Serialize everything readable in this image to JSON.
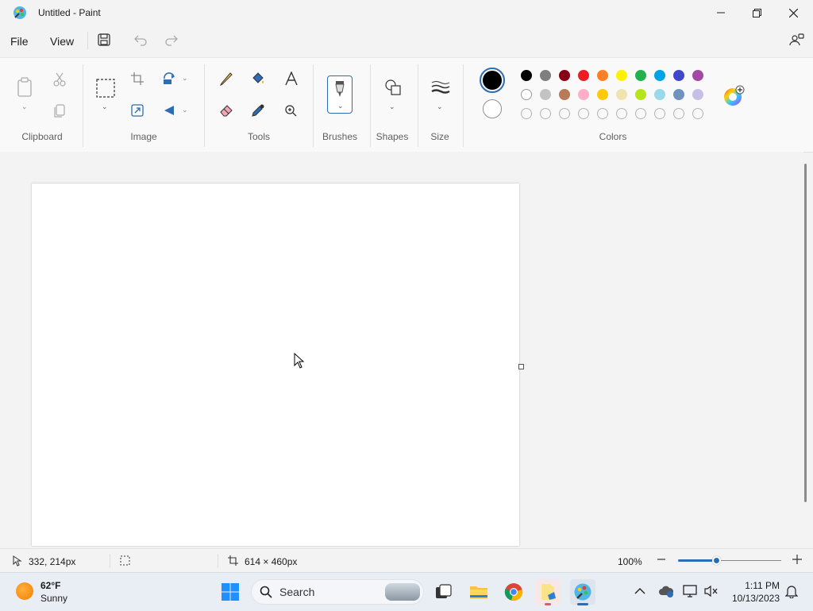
{
  "window": {
    "title": "Untitled - Paint"
  },
  "menu": {
    "file": "File",
    "view": "View"
  },
  "ribbon": {
    "groups": {
      "clipboard": "Clipboard",
      "image": "Image",
      "tools": "Tools",
      "brushes": "Brushes",
      "shapes": "Shapes",
      "size": "Size",
      "colors": "Colors"
    },
    "primary_color": "#000000",
    "secondary_color": "#ffffff",
    "palette_row1": [
      "#000000",
      "#7f7f7f",
      "#880015",
      "#ed1c24",
      "#ff7f27",
      "#fff200",
      "#22b14c",
      "#00a2e8",
      "#3f48cc",
      "#a349a4"
    ],
    "palette_row2": [
      "#ffffff",
      "#c3c3c3",
      "#b97a57",
      "#ffaec9",
      "#ffc90e",
      "#efe4b0",
      "#b5e61d",
      "#99d9ea",
      "#7092be",
      "#c8bfe7"
    ]
  },
  "status": {
    "cursor_pos": "332, 214px",
    "canvas_size": "614 × 460px",
    "zoom": "100%"
  },
  "taskbar": {
    "weather_temp": "62°F",
    "weather_desc": "Sunny",
    "search": "Search",
    "time": "1:11 PM",
    "date": "10/13/2023"
  }
}
